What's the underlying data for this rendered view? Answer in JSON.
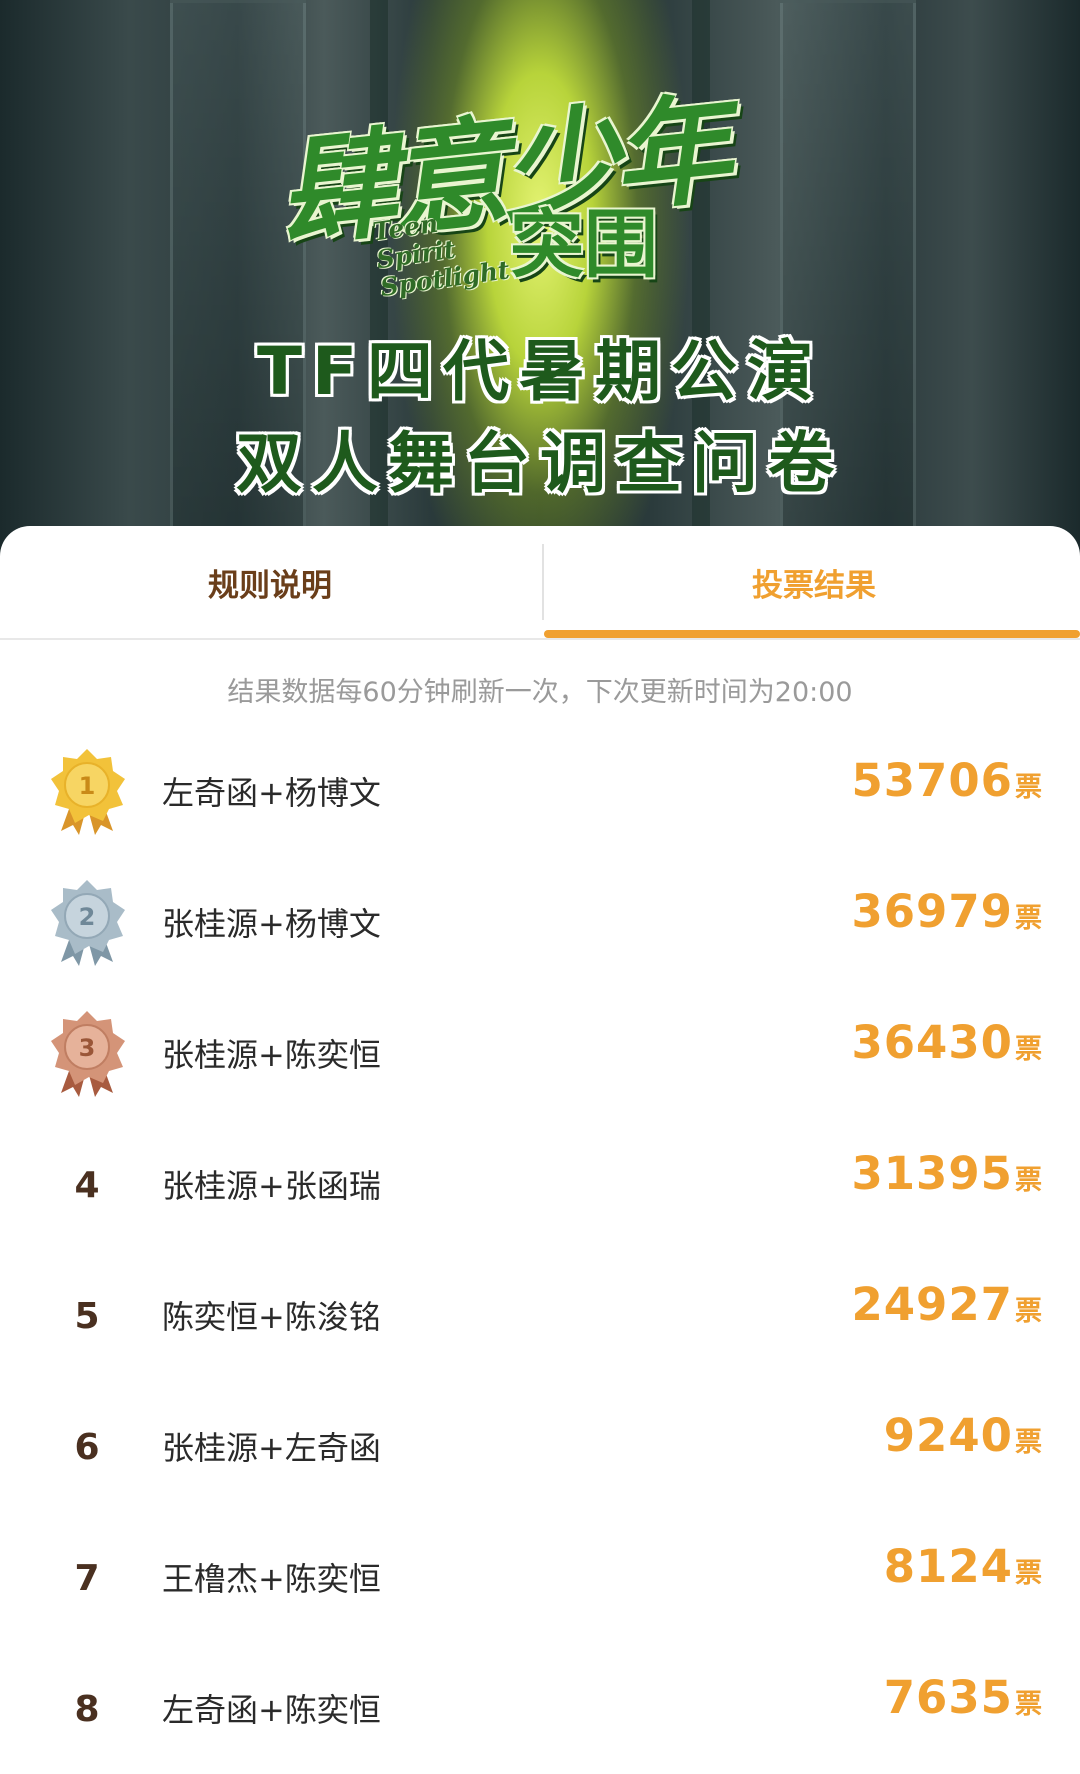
{
  "banner": {
    "logo_main": "肆意少年",
    "logo_sub": "突围",
    "logo_en_line1": "Teen Spirit",
    "logo_en_line2": "Spotlight",
    "title_line1": "TF四代暑期公演",
    "title_line2": "双人舞台调查问卷"
  },
  "tabs": {
    "rules_label": "规则说明",
    "results_label": "投票结果",
    "active": "results"
  },
  "notice": "结果数据每60分钟刷新一次，下次更新时间为20:00",
  "vote_unit": "票",
  "colors": {
    "accent": "#f0a030",
    "tab_inactive": "#6a3e1a",
    "gold": "#f2c23a",
    "silver": "#a9bcc8",
    "bronze": "#d49478"
  },
  "results": [
    {
      "rank": "1",
      "pair": "左奇函+杨博文",
      "votes": "53706",
      "medal": "gold-medal-icon"
    },
    {
      "rank": "2",
      "pair": "张桂源+杨博文",
      "votes": "36979",
      "medal": "silver-medal-icon"
    },
    {
      "rank": "3",
      "pair": "张桂源+陈奕恒",
      "votes": "36430",
      "medal": "bronze-medal-icon"
    },
    {
      "rank": "4",
      "pair": "张桂源+张函瑞",
      "votes": "31395"
    },
    {
      "rank": "5",
      "pair": "陈奕恒+陈浚铭",
      "votes": "24927"
    },
    {
      "rank": "6",
      "pair": "张桂源+左奇函",
      "votes": "9240"
    },
    {
      "rank": "7",
      "pair": "王橹杰+陈奕恒",
      "votes": "8124"
    },
    {
      "rank": "8",
      "pair": "左奇函+陈奕恒",
      "votes": "7635"
    }
  ]
}
